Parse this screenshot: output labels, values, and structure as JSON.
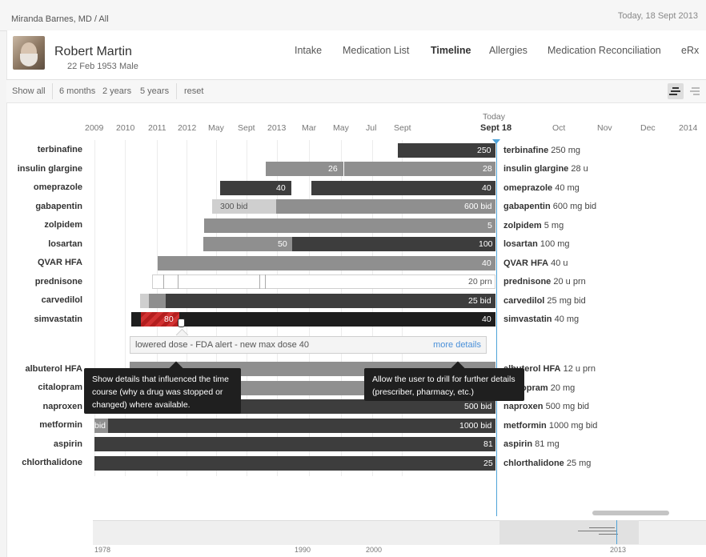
{
  "topbar": {
    "breadcrumb": "Miranda Barnes, MD / All",
    "today": "Today, 18 Sept 2013"
  },
  "patient": {
    "name": "Robert Martin",
    "dob": "22 Feb 1953",
    "sex": "Male"
  },
  "nav": [
    {
      "label": "Intake",
      "active": false
    },
    {
      "label": "Medication List",
      "active": false
    },
    {
      "label": "Timeline",
      "active": true
    },
    {
      "label": "Allergies",
      "active": false
    },
    {
      "label": "Medication Reconciliation",
      "active": false
    },
    {
      "label": "eRx",
      "active": false
    }
  ],
  "toolbar": {
    "show_all": "Show all",
    "six_months": "6 months",
    "two_years": "2 years",
    "five_years": "5 years",
    "reset": "reset"
  },
  "axis": {
    "labels": [
      "2009",
      "2010",
      "2011",
      "2012",
      "May",
      "Sept",
      "2013",
      "Mar",
      "May",
      "Jul",
      "Sept",
      "Oct",
      "Nov",
      "Dec",
      "2014"
    ],
    "today_label": "Today",
    "today_date": "Sept 18"
  },
  "medications": [
    {
      "name": "terbinafine",
      "value_label": "250",
      "desc_name": "terbinafine",
      "desc_dose": "250 mg"
    },
    {
      "name": "insulin glargine",
      "value_label": "28",
      "prior_label": "26",
      "desc_name": "insulin glargine",
      "desc_dose": "28 u"
    },
    {
      "name": "omeprazole",
      "value_label": "40",
      "prior_label": "40",
      "desc_name": "omeprazole",
      "desc_dose": "40 mg"
    },
    {
      "name": "gabapentin",
      "value_label": "600 bid",
      "prior_label": "300 bid",
      "desc_name": "gabapentin",
      "desc_dose": "600 mg bid"
    },
    {
      "name": "zolpidem",
      "value_label": "5",
      "desc_name": "zolpidem",
      "desc_dose": "5 mg"
    },
    {
      "name": "losartan",
      "value_label": "100",
      "prior_label": "50",
      "desc_name": "losartan",
      "desc_dose": "100 mg"
    },
    {
      "name": "QVAR HFA",
      "value_label": "40",
      "desc_name": "QVAR HFA",
      "desc_dose": "40 u"
    },
    {
      "name": "prednisone",
      "value_label": "20 prn",
      "desc_name": "prednisone",
      "desc_dose": "20 u prn"
    },
    {
      "name": "carvedilol",
      "value_label": "25 bid",
      "desc_name": "carvedilol",
      "desc_dose": " 25 mg bid"
    },
    {
      "name": "simvastatin",
      "value_label": "40",
      "prior_label": "80",
      "desc_name": "simvastatin",
      "desc_dose": "40 mg"
    },
    {
      "name": "albuterol HFA",
      "desc_name": "albuterol HFA",
      "desc_dose": "12 u prn"
    },
    {
      "name": "citalopram",
      "desc_name": "citalopram",
      "desc_dose": "20 mg"
    },
    {
      "name": "naproxen",
      "value_label": "500 bid",
      "desc_name": "naproxen",
      "desc_dose": " 500 mg bid"
    },
    {
      "name": "metformin",
      "value_label": "1000 bid",
      "prior_label": "bid",
      "desc_name": "metformin",
      "desc_dose": "1000 mg bid"
    },
    {
      "name": "aspirin",
      "value_label": "81",
      "desc_name": "aspirin",
      "desc_dose": "81 mg"
    },
    {
      "name": "chlorthalidone",
      "value_label": "25",
      "desc_name": "chlorthalidone",
      "desc_dose": "25 mg"
    }
  ],
  "detail": {
    "text": "lowered dose - FDA alert - new max dose 40",
    "more": "more details"
  },
  "tooltips": {
    "left": "Show details that influenced the time course (why a drug was stopped or changed) where available.",
    "right": "Allow the user to drill for further details (prescriber, pharmacy, etc.)"
  },
  "minimap": {
    "labels": [
      "1978",
      "1990",
      "2000",
      "2013"
    ]
  },
  "colors": {
    "today_line": "#4fa3d8",
    "dose_lowered_alert": "#c0292b",
    "link": "#4a90d9"
  }
}
